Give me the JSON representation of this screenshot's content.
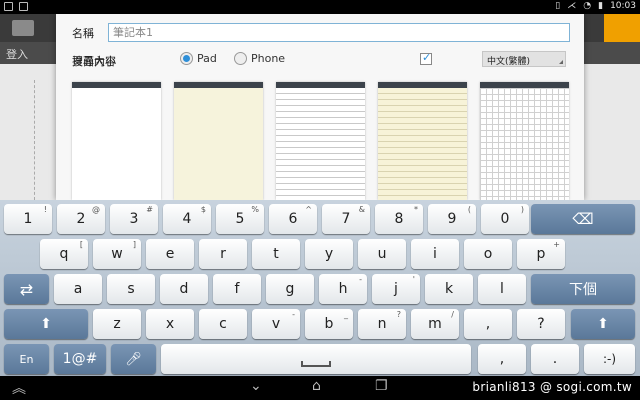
{
  "status": {
    "clock": "10:03"
  },
  "app": {
    "login_label": "登入"
  },
  "dialog": {
    "name_label": "名稱",
    "name_value": "筆記本1",
    "page_size_label": "頁面大小",
    "size_options": [
      {
        "label": "Pad",
        "selected": true
      },
      {
        "label": "Phone",
        "selected": false
      }
    ],
    "search_label": "搜尋內容",
    "search_checked": true,
    "language_value": "中文(繁體)",
    "accent_color": "#2e8fd8"
  },
  "keyboard": {
    "rows": [
      [
        {
          "l": "1",
          "s": "!"
        },
        {
          "l": "2",
          "s": "@"
        },
        {
          "l": "3",
          "s": "#"
        },
        {
          "l": "4",
          "s": "$"
        },
        {
          "l": "5",
          "s": "%"
        },
        {
          "l": "6",
          "s": "^"
        },
        {
          "l": "7",
          "s": "&"
        },
        {
          "l": "8",
          "s": "*"
        },
        {
          "l": "9",
          "s": "("
        },
        {
          "l": "0",
          "s": ")"
        }
      ],
      [
        {
          "l": "q",
          "s": "["
        },
        {
          "l": "w",
          "s": "]"
        },
        {
          "l": "e",
          "s": ""
        },
        {
          "l": "r",
          "s": ""
        },
        {
          "l": "t",
          "s": ""
        },
        {
          "l": "y",
          "s": ""
        },
        {
          "l": "u",
          "s": ""
        },
        {
          "l": "i",
          "s": ""
        },
        {
          "l": "o",
          "s": ""
        },
        {
          "l": "p",
          "s": "+"
        }
      ],
      [
        {
          "l": "a",
          "s": ""
        },
        {
          "l": "s",
          "s": ""
        },
        {
          "l": "d",
          "s": ""
        },
        {
          "l": "f",
          "s": ""
        },
        {
          "l": "g",
          "s": ""
        },
        {
          "l": "h",
          "s": "-"
        },
        {
          "l": "j",
          "s": "'"
        },
        {
          "l": "k",
          "s": ""
        },
        {
          "l": "l",
          "s": ""
        }
      ],
      [
        {
          "l": "z",
          "s": ""
        },
        {
          "l": "x",
          "s": ""
        },
        {
          "l": "c",
          "s": ""
        },
        {
          "l": "v",
          "s": "-"
        },
        {
          "l": "b",
          "s": "_"
        },
        {
          "l": "n",
          "s": "?"
        },
        {
          "l": "m",
          "s": "/"
        },
        {
          "l": ",",
          "s": ""
        },
        {
          "l": "?",
          "s": ""
        }
      ]
    ],
    "next_label": "下個",
    "lang_label": "En",
    "symbols_label": "1@#",
    "comma_label": ",",
    "period_label": ".",
    "smiley_label": ":-)"
  },
  "watermark": "brianli813  @ sogi.com.tw"
}
